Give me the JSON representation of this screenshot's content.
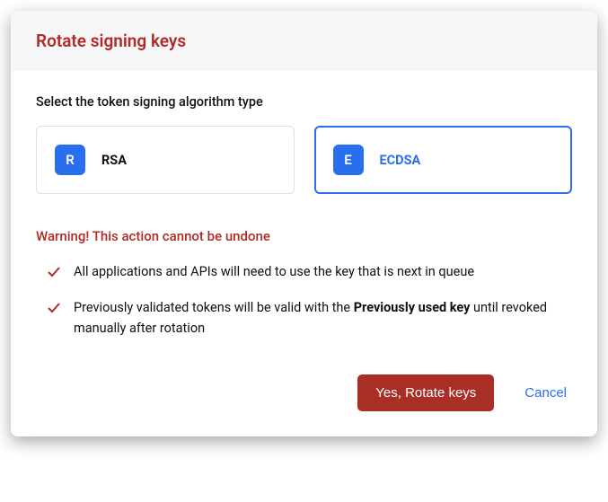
{
  "header": {
    "title": "Rotate signing keys"
  },
  "body": {
    "prompt": "Select the token signing algorithm type",
    "options": [
      {
        "badge": "R",
        "label": "RSA",
        "selected": false
      },
      {
        "badge": "E",
        "label": "ECDSA",
        "selected": true
      }
    ],
    "warning_title": "Warning! This action cannot be undone",
    "warnings": [
      {
        "text": "All applications and APIs will need to use the key that is next in queue"
      },
      {
        "prefix": "Previously validated tokens will be valid with the ",
        "bold": "Previously used key",
        "suffix": " until revoked manually after rotation"
      }
    ]
  },
  "footer": {
    "confirm": "Yes, Rotate keys",
    "cancel": "Cancel"
  },
  "colors": {
    "danger": "#b02a27",
    "primary": "#2a6ef0"
  }
}
